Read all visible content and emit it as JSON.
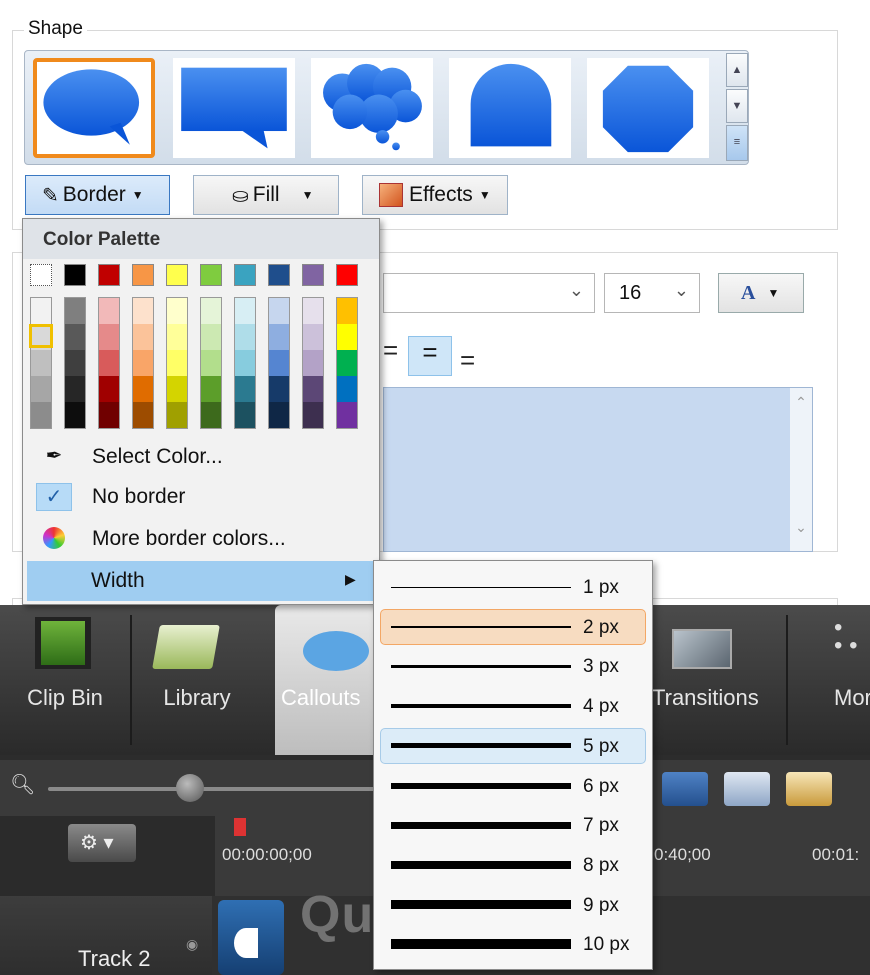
{
  "shape_group": {
    "title": "Shape"
  },
  "shape_gallery": {
    "items": [
      {
        "name": "speech-bubble-oval",
        "selected": true
      },
      {
        "name": "speech-bubble-rect",
        "selected": false
      },
      {
        "name": "thought-cloud",
        "selected": false
      },
      {
        "name": "rounded-callout",
        "selected": false
      },
      {
        "name": "octagon",
        "selected": false
      }
    ]
  },
  "toolbar": {
    "border_label": "Border",
    "fill_label": "Fill",
    "effects_label": "Effects"
  },
  "text_props": {
    "font_size": "16",
    "font_color_label": "A"
  },
  "color_menu": {
    "header": "Color Palette",
    "top_colors": [
      "none",
      "#000000",
      "#c00000",
      "#f79646",
      "#ffff4d",
      "#7fcc3f",
      "#3aa3c0",
      "#1f4e8c",
      "#8064a2",
      "#ff0000"
    ],
    "items": {
      "select_color": "Select Color...",
      "no_border": "No border",
      "more_colors": "More border colors...",
      "width": "Width"
    },
    "no_border_checked": true
  },
  "width_menu": {
    "items": [
      "1 px",
      "2 px",
      "3 px",
      "4 px",
      "5 px",
      "6 px",
      "7 px",
      "8 px",
      "9 px",
      "10 px"
    ],
    "selected": "2 px",
    "hovered": "5 px"
  },
  "tabs": {
    "clip_bin": "Clip Bin",
    "library": "Library",
    "callouts": "Callouts",
    "transitions": "Transitions",
    "more": "Mor"
  },
  "timeline": {
    "time_start": "00:00:00;00",
    "time_mid": "0:40;00",
    "time_end": "00:01:",
    "track_label": "Track 2"
  },
  "watermark": "Quantrimang"
}
